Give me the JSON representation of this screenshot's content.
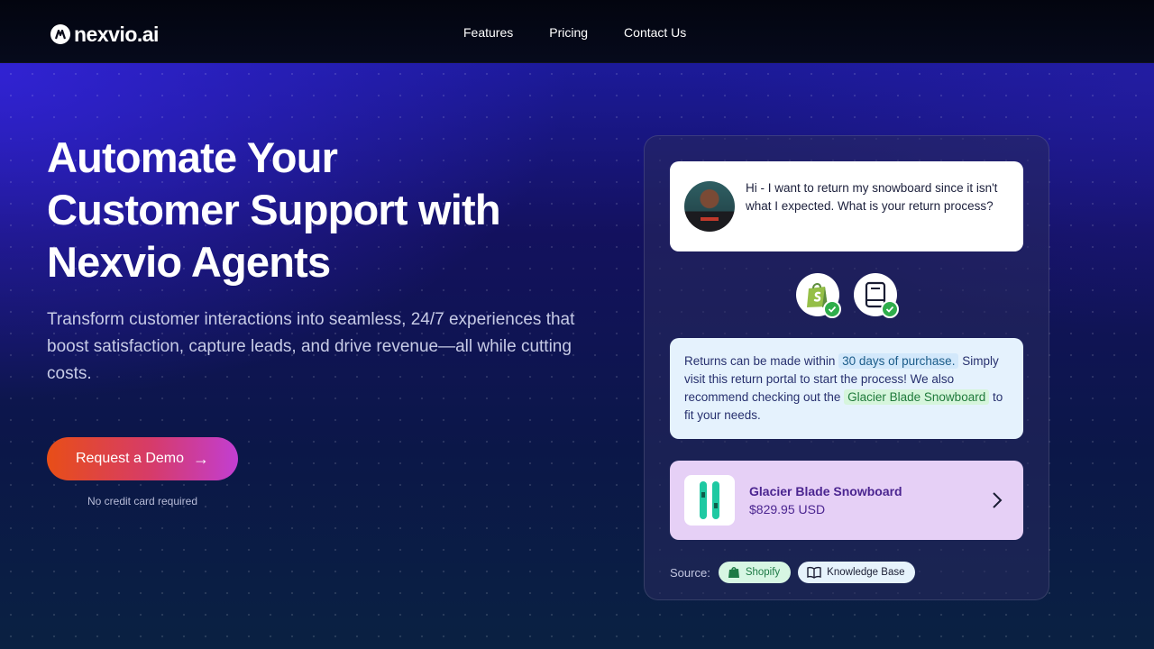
{
  "nav": {
    "logo_text": "nexvio.ai",
    "links": [
      {
        "label": "Features"
      },
      {
        "label": "Pricing"
      },
      {
        "label": "Contact Us"
      }
    ]
  },
  "hero": {
    "title_lines": [
      "Automate Your",
      "Customer Support with",
      "Nexvio Agents"
    ],
    "subtitle": "Transform customer interactions into seamless, 24/7 experiences that boost satisfaction, capture leads, and drive revenue—all while cutting costs.",
    "cta_label": "Request a Demo",
    "cta_arrow": "→",
    "cta_note": "No credit card required"
  },
  "chat": {
    "user_message": "Hi - I want to return my snowboard since it isn't what I expected. What is your return process?",
    "bot_message": {
      "part1": "Returns can be made within",
      "highlight1": "30 days of purchase.",
      "part2": "Simply visit this return portal to start the process! We also recommend checking out the",
      "highlight2": "Glacier Blade Snowboard",
      "part3": "to fit your needs."
    },
    "product": {
      "name": "Glacier Blade Snowboard",
      "price": "$829.95 USD"
    },
    "sources_label": "Source:",
    "sources": [
      {
        "label": "Shopify",
        "icon": "shopify-bag-icon"
      },
      {
        "label": "Knowledge Base",
        "icon": "open-book-icon"
      }
    ],
    "source_icons": [
      "shopify-bag-icon",
      "book-icon"
    ]
  },
  "colors": {
    "cta_start": "#e84e17",
    "cta_end": "#c23ed2",
    "check_green": "#2fae4b",
    "product_bg": "#e6d0f6",
    "bot_bg": "#e5f2fd"
  }
}
